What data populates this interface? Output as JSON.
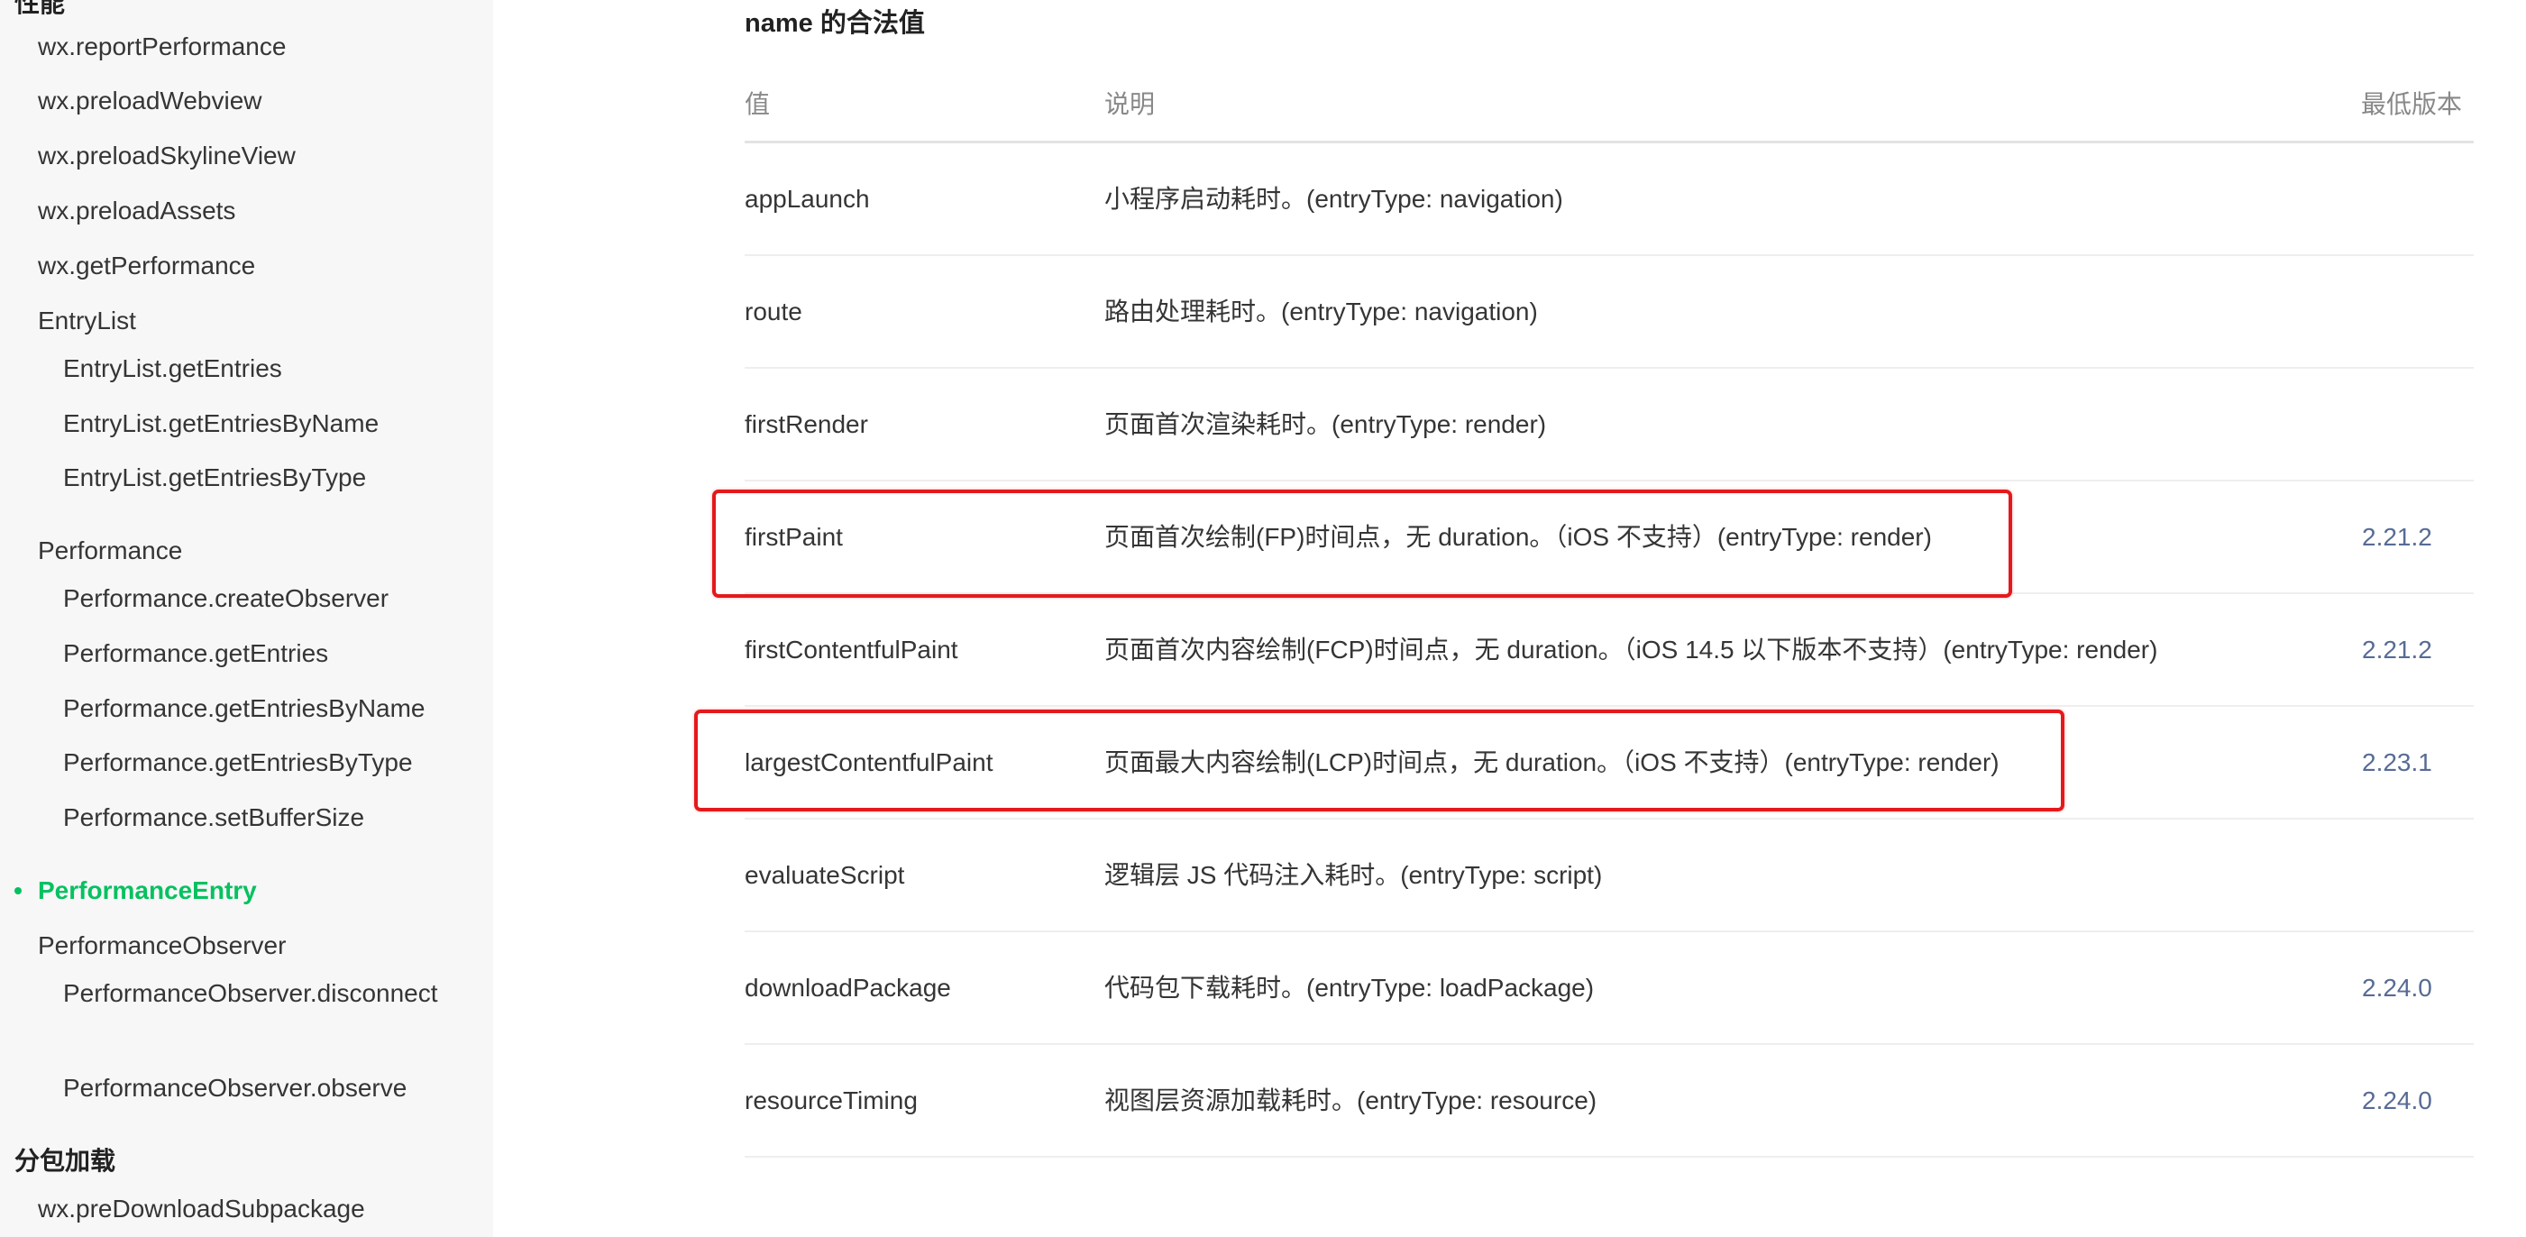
{
  "sidebar": {
    "group_top": "性能",
    "items_a": [
      "wx.reportPerformance",
      "wx.preloadWebview",
      "wx.preloadSkylineView",
      "wx.preloadAssets",
      "wx.getPerformance"
    ],
    "entrylist": {
      "label": "EntryList",
      "children": [
        "EntryList.getEntries",
        "EntryList.getEntriesByName",
        "EntryList.getEntriesByType"
      ]
    },
    "performance": {
      "label": "Performance",
      "children": [
        "Performance.createObserver",
        "Performance.getEntries",
        "Performance.getEntriesByName",
        "Performance.getEntriesByType",
        "Performance.setBufferSize"
      ]
    },
    "active_item": "PerformanceEntry",
    "observer": {
      "label": "PerformanceObserver",
      "children": [
        "PerformanceObserver.disconnect",
        "PerformanceObserver.observe"
      ]
    },
    "group_bottom": "分包加载",
    "items_b": [
      "wx.preDownloadSubpackage"
    ],
    "active_color": "#07c160"
  },
  "main": {
    "section_title": "name 的合法值",
    "headers": [
      "值",
      "说明",
      "最低版本"
    ],
    "rows": [
      {
        "value": "appLaunch",
        "desc": "小程序启动耗时。(entryType: navigation)",
        "version": ""
      },
      {
        "value": "route",
        "desc": "路由处理耗时。(entryType: navigation)",
        "version": ""
      },
      {
        "value": "firstRender",
        "desc": "页面首次渲染耗时。(entryType: render)",
        "version": ""
      },
      {
        "value": "firstPaint",
        "desc": "页面首次绘制(FP)时间点，无 duration。（iOS 不支持）(entryType: render)",
        "version": "2.21.2"
      },
      {
        "value": "firstContentfulPaint",
        "desc": "页面首次内容绘制(FCP)时间点，无 duration。（iOS 14.5 以下版本不支持）(entryType: render)",
        "version": "2.21.2"
      },
      {
        "value": "largestContentfulPaint",
        "desc": "页面最大内容绘制(LCP)时间点，无 duration。（iOS 不支持）(entryType: render)",
        "version": "2.23.1"
      },
      {
        "value": "evaluateScript",
        "desc": "逻辑层 JS 代码注入耗时。(entryType: script)",
        "version": ""
      },
      {
        "value": "downloadPackage",
        "desc": "代码包下载耗时。(entryType: loadPackage)",
        "version": "2.24.0"
      },
      {
        "value": "resourceTiming",
        "desc": "视图层资源加载耗时。(entryType: resource)",
        "version": "2.24.0"
      }
    ],
    "link_color": "#576b95",
    "highlight_color": "#e5191b"
  }
}
